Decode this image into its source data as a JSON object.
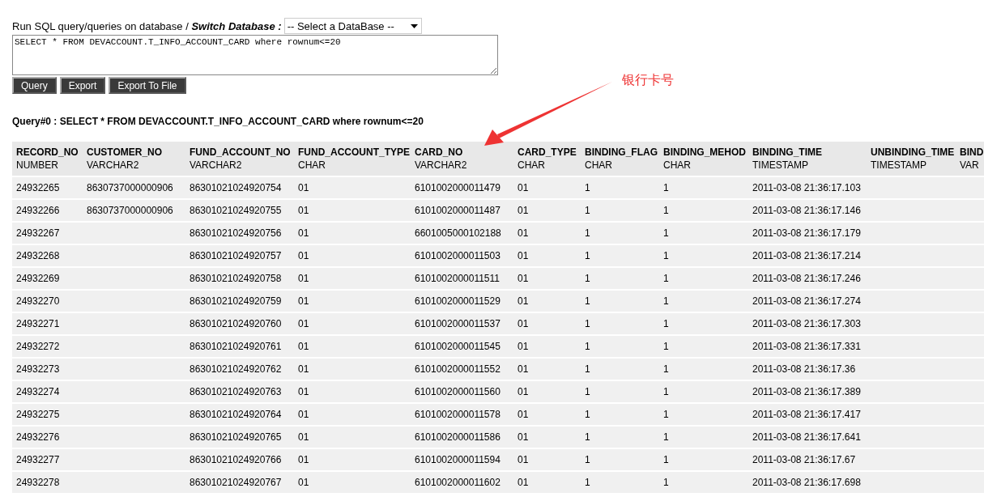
{
  "query_form": {
    "label": "Run SQL query/queries on database / **Switch Database :**",
    "database_select": {
      "value": "-- Select a DataBase --"
    },
    "sql_editor": {
      "value": "SELECT * FROM DEVACCOUNT.T_INFO_ACCOUNT_CARD where rownum<=20"
    },
    "buttons": [
      "Query",
      "Export",
      "Export To File"
    ]
  },
  "result_title": "Query#0 : SELECT * FROM DEVACCOUNT.T_INFO_ACCOUNT_CARD where rownum<=20",
  "annotation": {
    "text": "银行卡号"
  },
  "table": {
    "columns": [
      {
        "name": "RECORD_NO",
        "type": "NUMBER"
      },
      {
        "name": "CUSTOMER_NO",
        "type": "VARCHAR2"
      },
      {
        "name": "FUND_ACCOUNT_NO",
        "type": "VARCHAR2"
      },
      {
        "name": "FUND_ACCOUNT_TYPE",
        "type": "CHAR"
      },
      {
        "name": "CARD_NO",
        "type": "VARCHAR2"
      },
      {
        "name": "CARD_TYPE",
        "type": "CHAR"
      },
      {
        "name": "BINDING_FLAG",
        "type": "CHAR"
      },
      {
        "name": "BINDING_MEHOD",
        "type": "CHAR"
      },
      {
        "name": "BINDING_TIME",
        "type": "TIMESTAMP"
      },
      {
        "name": "UNBINDING_TIME",
        "type": "TIMESTAMP"
      },
      {
        "name": "BIND",
        "type": "VAR"
      }
    ],
    "rows": [
      [
        "24932265",
        "8630737000000906",
        "86301021024920754",
        "01",
        "6101002000011479",
        "01",
        "1",
        "1",
        "2011-03-08 21:36:17.103",
        null,
        null
      ],
      [
        "24932266",
        "8630737000000906",
        "86301021024920755",
        "01",
        "6101002000011487",
        "01",
        "1",
        "1",
        "2011-03-08 21:36:17.146",
        null,
        null
      ],
      [
        "24932267",
        null,
        "86301021024920756",
        "01",
        "6601005000102188",
        "01",
        "1",
        "1",
        "2011-03-08 21:36:17.179",
        null,
        null
      ],
      [
        "24932268",
        null,
        "86301021024920757",
        "01",
        "6101002000011503",
        "01",
        "1",
        "1",
        "2011-03-08 21:36:17.214",
        null,
        null
      ],
      [
        "24932269",
        null,
        "86301021024920758",
        "01",
        "6101002000011511",
        "01",
        "1",
        "1",
        "2011-03-08 21:36:17.246",
        null,
        null
      ],
      [
        "24932270",
        null,
        "86301021024920759",
        "01",
        "6101002000011529",
        "01",
        "1",
        "1",
        "2011-03-08 21:36:17.274",
        null,
        null
      ],
      [
        "24932271",
        null,
        "86301021024920760",
        "01",
        "6101002000011537",
        "01",
        "1",
        "1",
        "2011-03-08 21:36:17.303",
        null,
        null
      ],
      [
        "24932272",
        null,
        "86301021024920761",
        "01",
        "6101002000011545",
        "01",
        "1",
        "1",
        "2011-03-08 21:36:17.331",
        null,
        null
      ],
      [
        "24932273",
        null,
        "86301021024920762",
        "01",
        "6101002000011552",
        "01",
        "1",
        "1",
        "2011-03-08 21:36:17.36",
        null,
        null
      ],
      [
        "24932274",
        null,
        "86301021024920763",
        "01",
        "6101002000011560",
        "01",
        "1",
        "1",
        "2011-03-08 21:36:17.389",
        null,
        null
      ],
      [
        "24932275",
        null,
        "86301021024920764",
        "01",
        "6101002000011578",
        "01",
        "1",
        "1",
        "2011-03-08 21:36:17.417",
        null,
        null
      ],
      [
        "24932276",
        null,
        "86301021024920765",
        "01",
        "6101002000011586",
        "01",
        "1",
        "1",
        "2011-03-08 21:36:17.641",
        null,
        null
      ],
      [
        "24932277",
        null,
        "86301021024920766",
        "01",
        "6101002000011594",
        "01",
        "1",
        "1",
        "2011-03-08 21:36:17.67",
        null,
        null
      ],
      [
        "24932278",
        null,
        "86301021024920767",
        "01",
        "6101002000011602",
        "01",
        "1",
        "1",
        "2011-03-08 21:36:17.698",
        null,
        null
      ]
    ]
  }
}
